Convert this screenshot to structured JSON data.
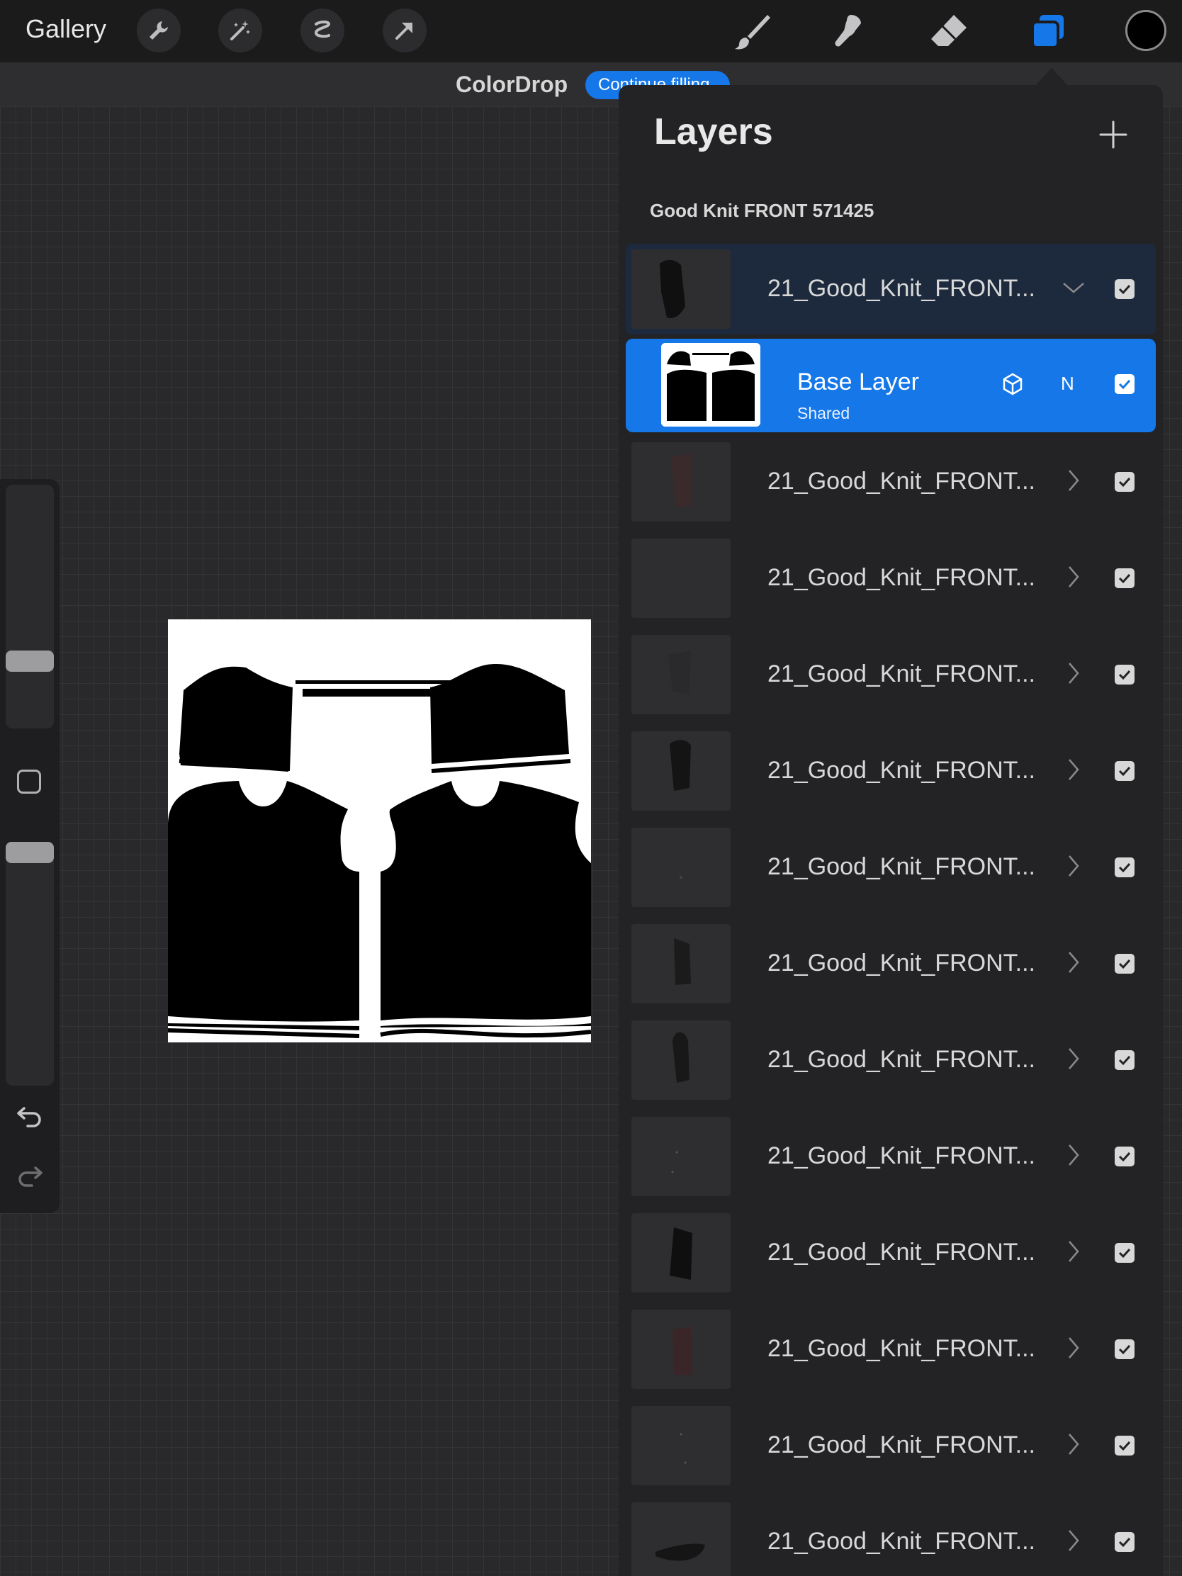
{
  "topbar": {
    "gallery_label": "Gallery",
    "left_tools": [
      "wrench-icon",
      "magic-wand-icon",
      "selection-icon",
      "transform-arrow-icon"
    ],
    "right_tools": [
      "brush-icon",
      "smudge-icon",
      "eraser-icon",
      "layers-icon"
    ],
    "active_color": "#000000"
  },
  "colordrop": {
    "label": "ColorDrop",
    "pill_text": "Continue filling"
  },
  "layers_panel": {
    "title": "Layers",
    "group_name": "Good Knit FRONT 571425",
    "group_row": {
      "name": "21_Good_Knit_FRONT...",
      "expanded": true,
      "visible": true
    },
    "active_layer": {
      "name": "Base Layer",
      "sub": "Shared",
      "blend": "N",
      "visible": true
    },
    "layers": [
      {
        "name": "21_Good_Knit_FRONT...",
        "visible": true
      },
      {
        "name": "21_Good_Knit_FRONT...",
        "visible": true
      },
      {
        "name": "21_Good_Knit_FRONT...",
        "visible": true
      },
      {
        "name": "21_Good_Knit_FRONT...",
        "visible": true
      },
      {
        "name": "21_Good_Knit_FRONT...",
        "visible": true
      },
      {
        "name": "21_Good_Knit_FRONT...",
        "visible": true
      },
      {
        "name": "21_Good_Knit_FRONT...",
        "visible": true
      },
      {
        "name": "21_Good_Knit_FRONT...",
        "visible": true
      },
      {
        "name": "21_Good_Knit_FRONT...",
        "visible": true
      },
      {
        "name": "21_Good_Knit_FRONT...",
        "visible": true
      },
      {
        "name": "21_Good_Knit_FRONT...",
        "visible": true
      },
      {
        "name": "21_Good_Knit_FRONT...",
        "visible": true
      }
    ]
  },
  "colors": {
    "accent": "#1677e8",
    "panel": "#232325",
    "toolbar": "#1b1b1c"
  }
}
